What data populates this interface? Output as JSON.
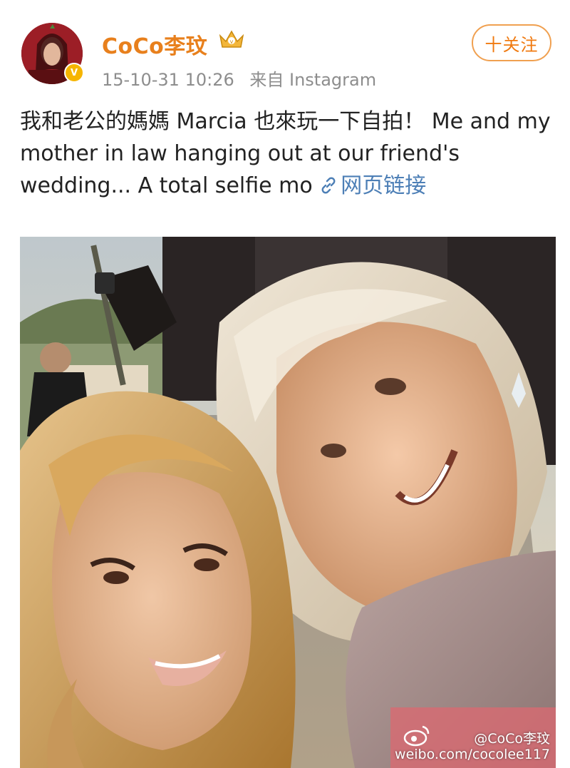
{
  "post": {
    "username": "CoCo李玟",
    "timestamp": "15-10-31 10:26",
    "source": "来自 Instagram",
    "follow_label": "十关注",
    "text": "我和老公的媽媽 Marcia 也來玩一下自拍！  Me and my mother in law hanging out at our friend's wedding... A total selfie mo ",
    "link_label": "网页链接"
  },
  "icons": {
    "verified": "verified-v-badge",
    "member": "crown-vip-icon",
    "link": "link-chain-icon",
    "weibo": "weibo-logo-icon"
  },
  "photo": {
    "watermark_handle": "@CoCo李玟",
    "watermark_url": "weibo.com/cocolee117"
  },
  "colors": {
    "username": "#e8801d",
    "meta": "#8d8d8d",
    "link": "#4d7fb6",
    "follow": "#f07a10"
  }
}
